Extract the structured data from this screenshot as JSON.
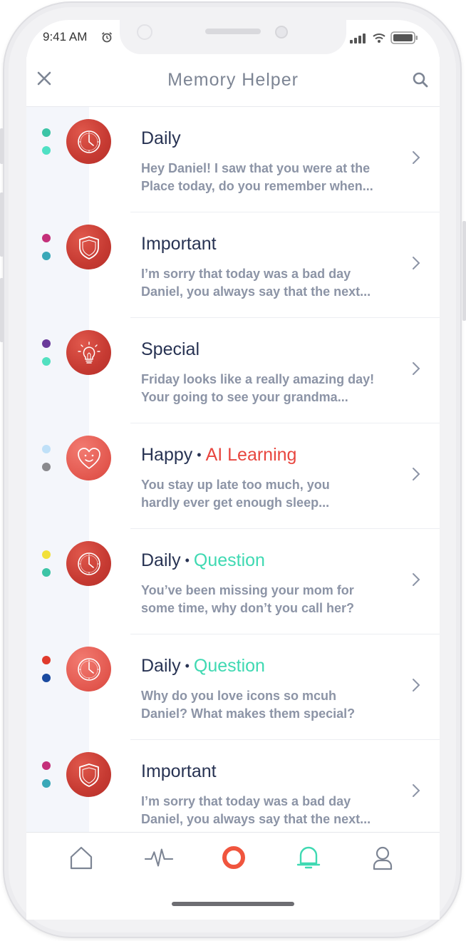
{
  "status_bar": {
    "time": "9:41 AM"
  },
  "header": {
    "title": "Memory Helper"
  },
  "items": [
    {
      "title": "Daily",
      "tag": "",
      "tag_color": "",
      "line1": "Hey Daniel! I saw that you were at the",
      "line2": "Place today, do you remember when...",
      "icon": "clock-icon",
      "dot_top": "#3cc4a6",
      "dot_bottom": "#4fe0c4"
    },
    {
      "title": "Important",
      "tag": "",
      "tag_color": "",
      "line1": "I’m sorry that today was a bad day",
      "line2": "Daniel, you always say that the next...",
      "icon": "shield-icon",
      "dot_top": "#c4307a",
      "dot_bottom": "#3aa8b8"
    },
    {
      "title": "Special",
      "tag": "",
      "tag_color": "",
      "line1": "Friday looks like a really amazing day!",
      "line2": "Your going to see your grandma...",
      "icon": "lightbulb-icon",
      "dot_top": "#6a3a9a",
      "dot_bottom": "#52e0c0"
    },
    {
      "title": "Happy",
      "tag": "AI Learning",
      "tag_color": "#e8463f",
      "line1": "You stay up late too much, you",
      "line2": "hardly ever get enough sleep...",
      "icon": "heart-face-icon",
      "dot_top": "#bfe0f8",
      "dot_bottom": "#8a8a8e"
    },
    {
      "title": "Daily",
      "tag": "Question",
      "tag_color": "#3fd9b2",
      "line1": "You’ve been missing your mom for",
      "line2": "some time, why don’t you call her?",
      "icon": "clock-icon",
      "dot_top": "#f2e03a",
      "dot_bottom": "#3cc4a6"
    },
    {
      "title": "Daily",
      "tag": "Question",
      "tag_color": "#3fd9b2",
      "line1": "Why do you love icons so mcuh",
      "line2": "Daniel? What makes them special?",
      "icon": "clock-icon",
      "dot_top": "#e03a2c",
      "dot_bottom": "#1a4aa0"
    },
    {
      "title": "Important",
      "tag": "",
      "tag_color": "",
      "line1": "I’m sorry that today was a bad day",
      "line2": "Daniel, you always say that the next...",
      "icon": "shield-icon",
      "dot_top": "#c4307a",
      "dot_bottom": "#3aa8b8"
    }
  ],
  "tabs": [
    {
      "icon": "home-icon",
      "active": false
    },
    {
      "icon": "pulse-icon",
      "active": false
    },
    {
      "icon": "ring-icon",
      "active": false
    },
    {
      "icon": "bell-icon",
      "active": true
    },
    {
      "icon": "profile-icon",
      "active": false
    }
  ],
  "colors": {
    "accent": "#3fd9b2",
    "alert": "#e8463f",
    "title": "#283353",
    "muted": "#8c94a6"
  }
}
